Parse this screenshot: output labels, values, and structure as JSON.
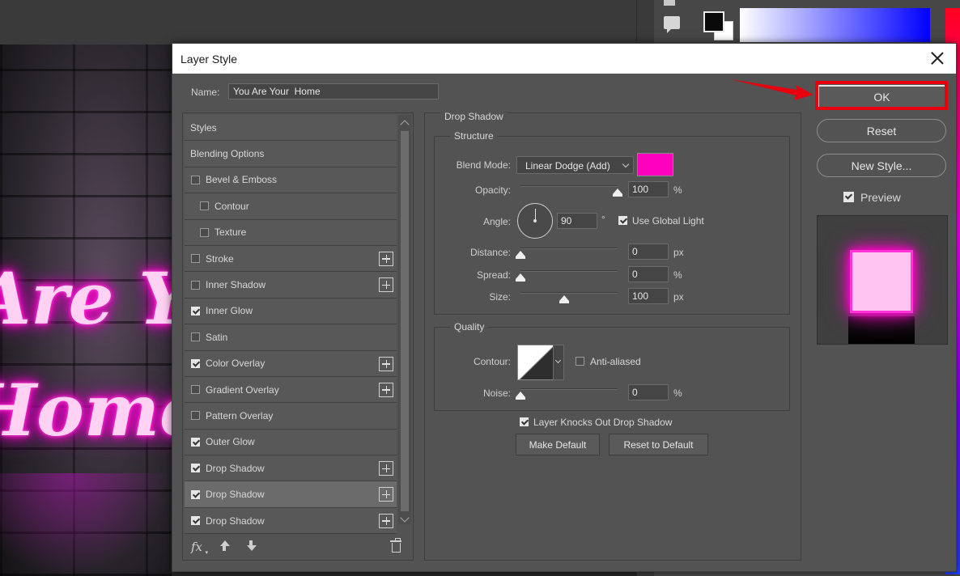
{
  "canvas": {
    "neon_line1": "Are Yo",
    "neon_line2": "Home"
  },
  "dialog": {
    "title": "Layer Style",
    "name_label": "Name:",
    "name_value": "You Are Your  Home"
  },
  "styles_list": [
    {
      "label": "Styles",
      "kind": "plain"
    },
    {
      "label": "Blending Options",
      "kind": "plain"
    },
    {
      "label": "Bevel & Emboss",
      "checked": false
    },
    {
      "label": "Contour",
      "checked": false,
      "sub": true
    },
    {
      "label": "Texture",
      "checked": false,
      "sub": true
    },
    {
      "label": "Stroke",
      "checked": false,
      "plus": true
    },
    {
      "label": "Inner Shadow",
      "checked": false,
      "plus": true
    },
    {
      "label": "Inner Glow",
      "checked": true
    },
    {
      "label": "Satin",
      "checked": false
    },
    {
      "label": "Color Overlay",
      "checked": true,
      "plus": true
    },
    {
      "label": "Gradient Overlay",
      "checked": false,
      "plus": true
    },
    {
      "label": "Pattern Overlay",
      "checked": false
    },
    {
      "label": "Outer Glow",
      "checked": true
    },
    {
      "label": "Drop Shadow",
      "checked": true,
      "plus": true
    },
    {
      "label": "Drop Shadow",
      "checked": true,
      "plus": true,
      "selected": true
    },
    {
      "label": "Drop Shadow",
      "checked": true,
      "plus": true
    }
  ],
  "drop_shadow": {
    "section_title": "Drop Shadow",
    "structure_title": "Structure",
    "blend_mode_label": "Blend Mode:",
    "blend_mode_value": "Linear Dodge (Add)",
    "shadow_color": "#ff00bf",
    "opacity_label": "Opacity:",
    "opacity_value": "100",
    "opacity_unit": "%",
    "opacity_fraction": 1.0,
    "angle_label": "Angle:",
    "angle_value": "90",
    "angle_unit": "°",
    "use_global_light_label": "Use Global Light",
    "use_global_light": true,
    "distance_label": "Distance:",
    "distance_value": "0",
    "distance_unit": "px",
    "distance_fraction": 0.0,
    "spread_label": "Spread:",
    "spread_value": "0",
    "spread_unit": "%",
    "spread_fraction": 0.0,
    "size_label": "Size:",
    "size_value": "100",
    "size_unit": "px",
    "size_fraction": 0.45,
    "quality_title": "Quality",
    "contour_label": "Contour:",
    "anti_aliased_label": "Anti-aliased",
    "anti_aliased": false,
    "noise_label": "Noise:",
    "noise_value": "0",
    "noise_unit": "%",
    "noise_fraction": 0.0,
    "knocks_out_label": "Layer Knocks Out Drop Shadow",
    "knocks_out": true,
    "make_default_label": "Make Default",
    "reset_default_label": "Reset to Default"
  },
  "actions": {
    "ok_label": "OK",
    "reset_label": "Reset",
    "new_style_label": "New Style...",
    "preview_label": "Preview",
    "preview_checked": true
  },
  "colors": {
    "highlight_red": "#e8000f",
    "neon_pink": "#ff00cc"
  }
}
